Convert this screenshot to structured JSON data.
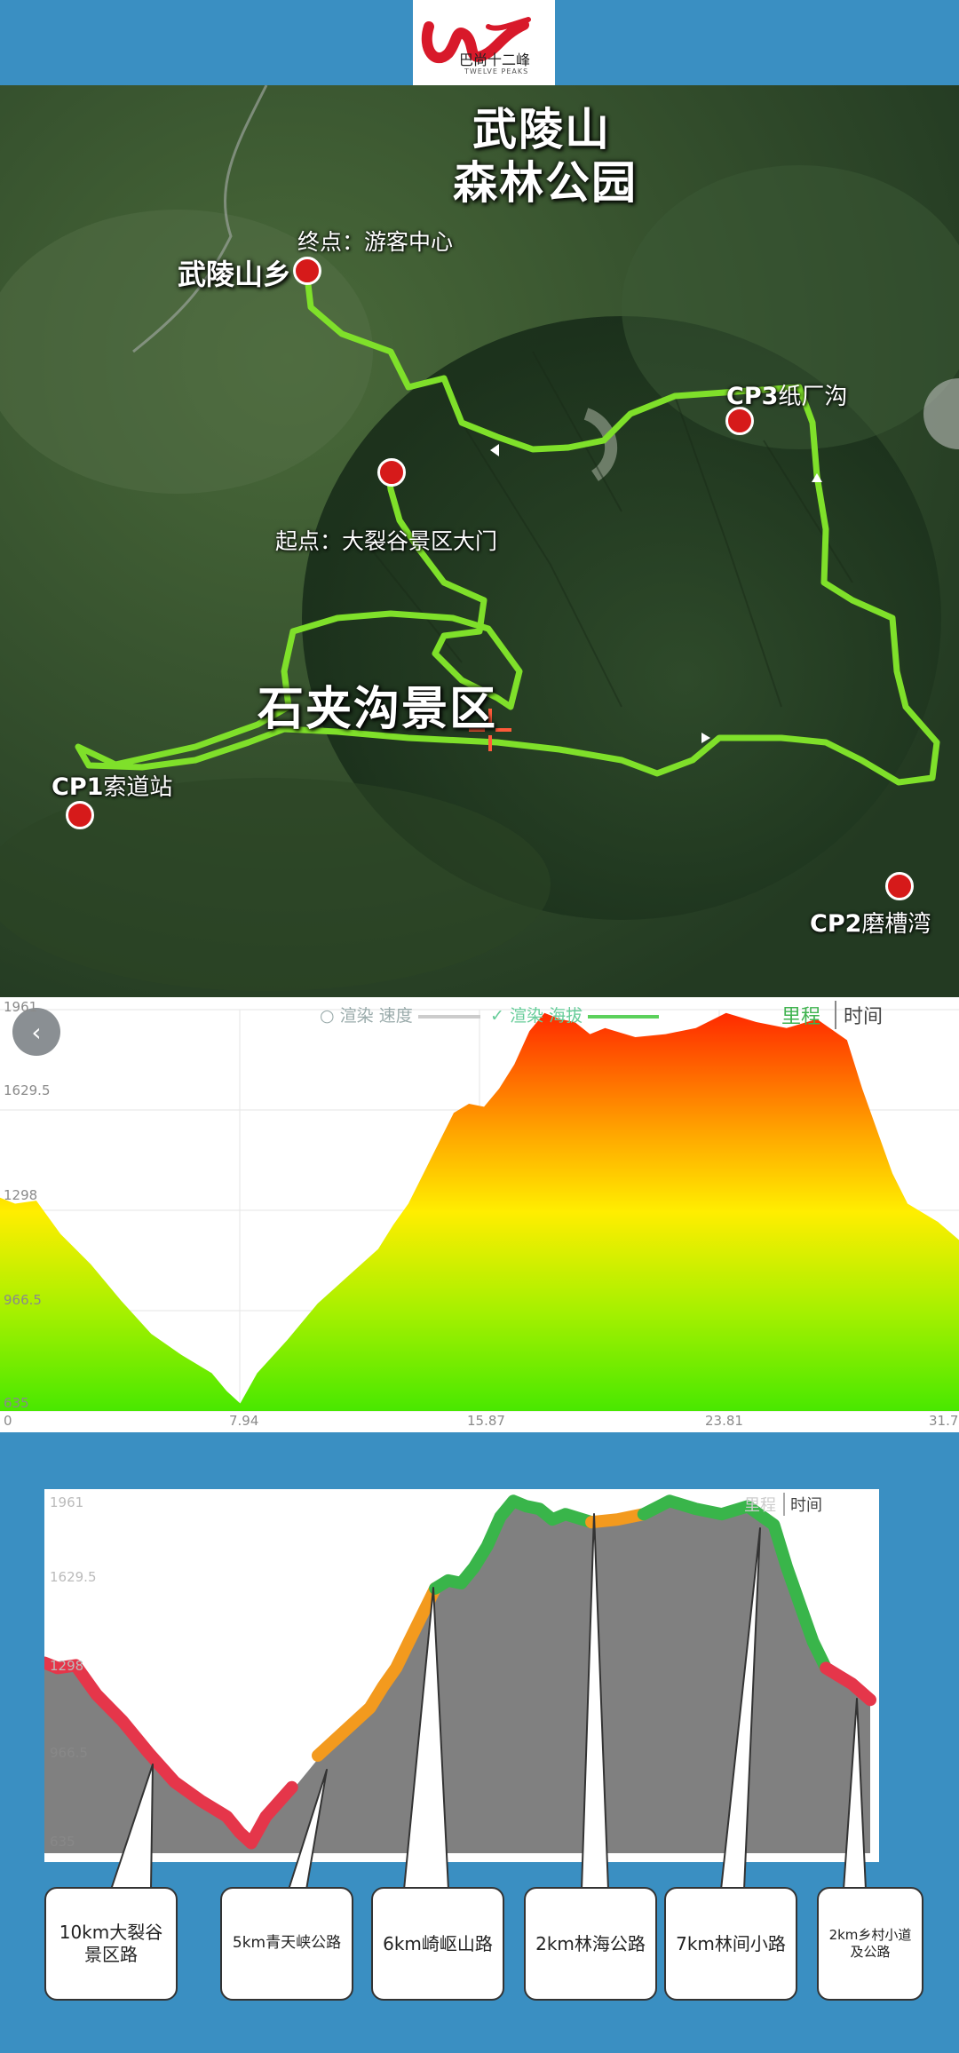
{
  "header": {
    "logo_icon": "ba-shang-twelve-peaks-logo",
    "logo_text": "巴尚十二峰",
    "logo_subtext": "TWELVE PEAKS"
  },
  "map": {
    "titles": {
      "park": "武陵山\n森林公园",
      "scenic_area": "石夹沟景区"
    },
    "town_label": "武陵山乡",
    "finish_label": "终点：游客中心",
    "start_label": "起点：大裂谷景区大门",
    "checkpoints": [
      {
        "code": "CP1",
        "name": "索道站"
      },
      {
        "code": "CP2",
        "name": "磨槽湾"
      },
      {
        "code": "CP3",
        "name": "纸厂沟"
      }
    ],
    "route_color": "#7fe02a",
    "marker_color": "#d61a1a"
  },
  "elevation_chart": {
    "back_icon": "back-arrow-icon",
    "legend": [
      {
        "check": "○",
        "label": "渲染",
        "series": "速度"
      },
      {
        "check": "✓",
        "label": "渲染",
        "series": "海拔"
      }
    ],
    "tabs": [
      "里程",
      "时间"
    ],
    "y_ticks": [
      "1961",
      "1629.5",
      "1298",
      "966.5",
      "635"
    ],
    "x_ticks": [
      "0",
      "7.94",
      "15.87",
      "23.81",
      "31.7"
    ]
  },
  "chart_data": {
    "type": "area",
    "xlabel": "",
    "ylabel": "",
    "ylim": [
      635,
      1961
    ],
    "xlim": [
      0,
      31.7
    ],
    "series": [
      {
        "x": [
          0,
          0.5,
          1.2,
          2,
          3,
          4,
          5,
          6,
          7,
          7.5,
          7.94,
          8.5,
          9.5,
          10.5,
          11.5,
          12.5,
          13,
          13.5,
          14,
          14.5,
          15,
          15.5,
          16,
          16.5,
          17,
          17.5,
          18,
          18.5,
          19,
          19.5,
          20,
          21,
          22,
          23,
          24,
          25,
          26,
          27,
          28,
          28.5,
          29,
          29.5,
          30,
          30.5,
          31,
          31.7
        ],
        "y": [
          1340,
          1320,
          1330,
          1220,
          1120,
          1000,
          890,
          820,
          760,
          700,
          660,
          760,
          870,
          990,
          1080,
          1170,
          1250,
          1320,
          1420,
          1520,
          1620,
          1650,
          1640,
          1700,
          1780,
          1890,
          1950,
          1930,
          1920,
          1880,
          1900,
          1870,
          1880,
          1900,
          1950,
          1920,
          1900,
          1930,
          1860,
          1700,
          1560,
          1420,
          1320,
          1290,
          1260,
          1200
        ]
      }
    ]
  },
  "annotated_chart": {
    "y_ticks": [
      "1961",
      "1629.5",
      "1298",
      "966.5",
      "635"
    ],
    "tab_partial": "里程",
    "tab_time": "时间",
    "segments": [
      {
        "label": "10km大裂谷景区路",
        "color": "#e5364a"
      },
      {
        "label": "5km青天峡公路",
        "color": "#f39a1e"
      },
      {
        "label": "6km崎岖山路",
        "color": "#39b54a"
      },
      {
        "label": "2km林海公路",
        "color": "#f39a1e"
      },
      {
        "label": "7km林间小路",
        "color": "#39b54a"
      },
      {
        "label": "2km乡村小道及公路",
        "color": "#e5364a"
      }
    ]
  }
}
